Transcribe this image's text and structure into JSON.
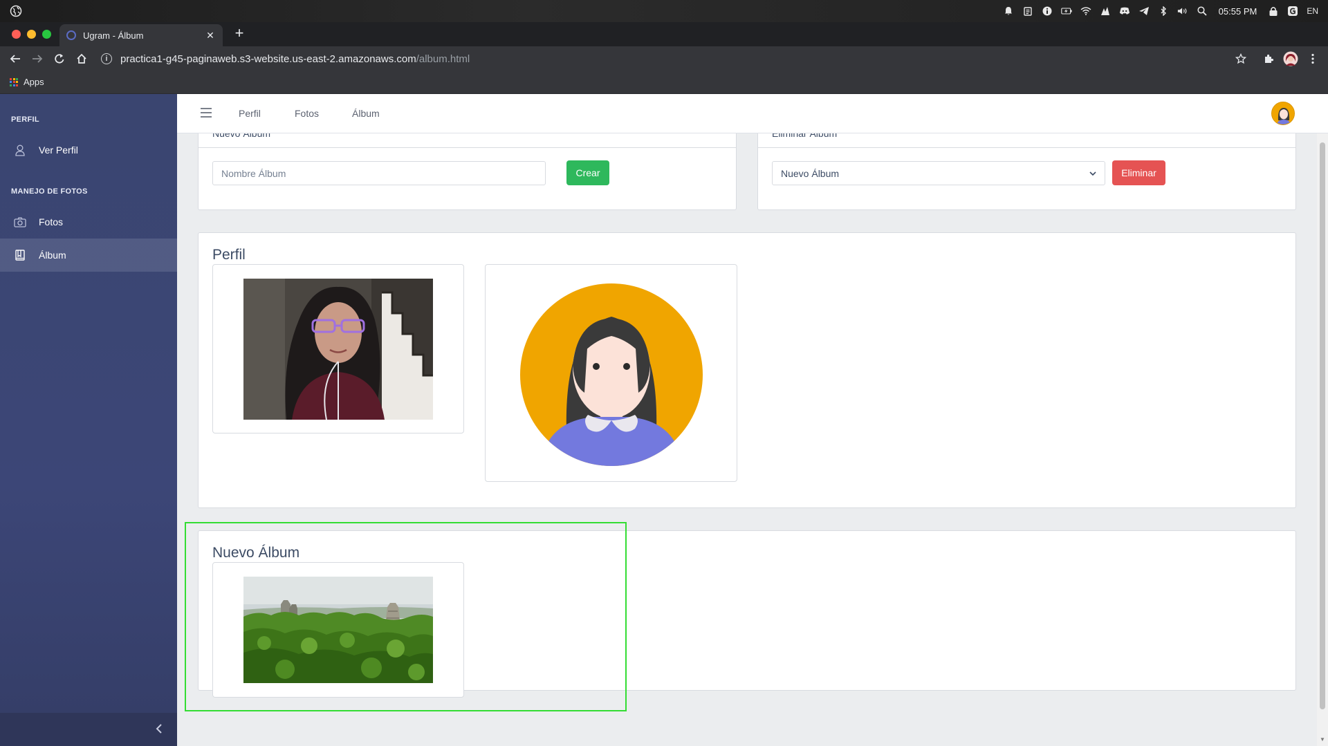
{
  "os": {
    "clock": "05:55 PM",
    "language": "EN",
    "tray_icons": [
      "bell-icon",
      "clipboard-icon",
      "info-icon",
      "battery-icon",
      "wifi-icon",
      "steam-icon",
      "discord-icon",
      "telegram-icon",
      "bluetooth-icon",
      "volume-icon",
      "search-icon",
      "lock-icon",
      "app-icon"
    ]
  },
  "browser": {
    "tab_title": "Ugram - Álbum",
    "url_host": "practica1-g45-paginaweb.s3-website.us-east-2.amazonaws.com",
    "url_path": "/album.html",
    "bookmarks_apps": "Apps"
  },
  "sidebar": {
    "section_profile": "PERFIL",
    "item_ver_perfil": "Ver Perfil",
    "section_photos": "MANEJO DE FOTOS",
    "item_fotos": "Fotos",
    "item_album": "Álbum"
  },
  "header": {
    "nav": [
      "Perfil",
      "Fotos",
      "Álbum"
    ]
  },
  "forms": {
    "new_album_title": "Nuevo Álbum",
    "new_album_placeholder": "Nombre Álbum",
    "create_button": "Crear",
    "delete_album_title": "Eliminar Álbum",
    "delete_select_value": "Nuevo Álbum",
    "delete_button": "Eliminar"
  },
  "albums": [
    {
      "name": "Perfil",
      "photos": [
        "webcam-portrait-photo",
        "cartoon-avatar-image"
      ]
    },
    {
      "name": "Nuevo Álbum",
      "photos": [
        "jungle-temples-landscape-photo"
      ]
    }
  ],
  "colors": {
    "sidebar": "#3c4677",
    "create_button": "#2eb85c",
    "delete_button": "#e55353",
    "title_text": "#3c4b64",
    "avatar_bg": "#f0a500",
    "highlight": "#33dd33"
  }
}
